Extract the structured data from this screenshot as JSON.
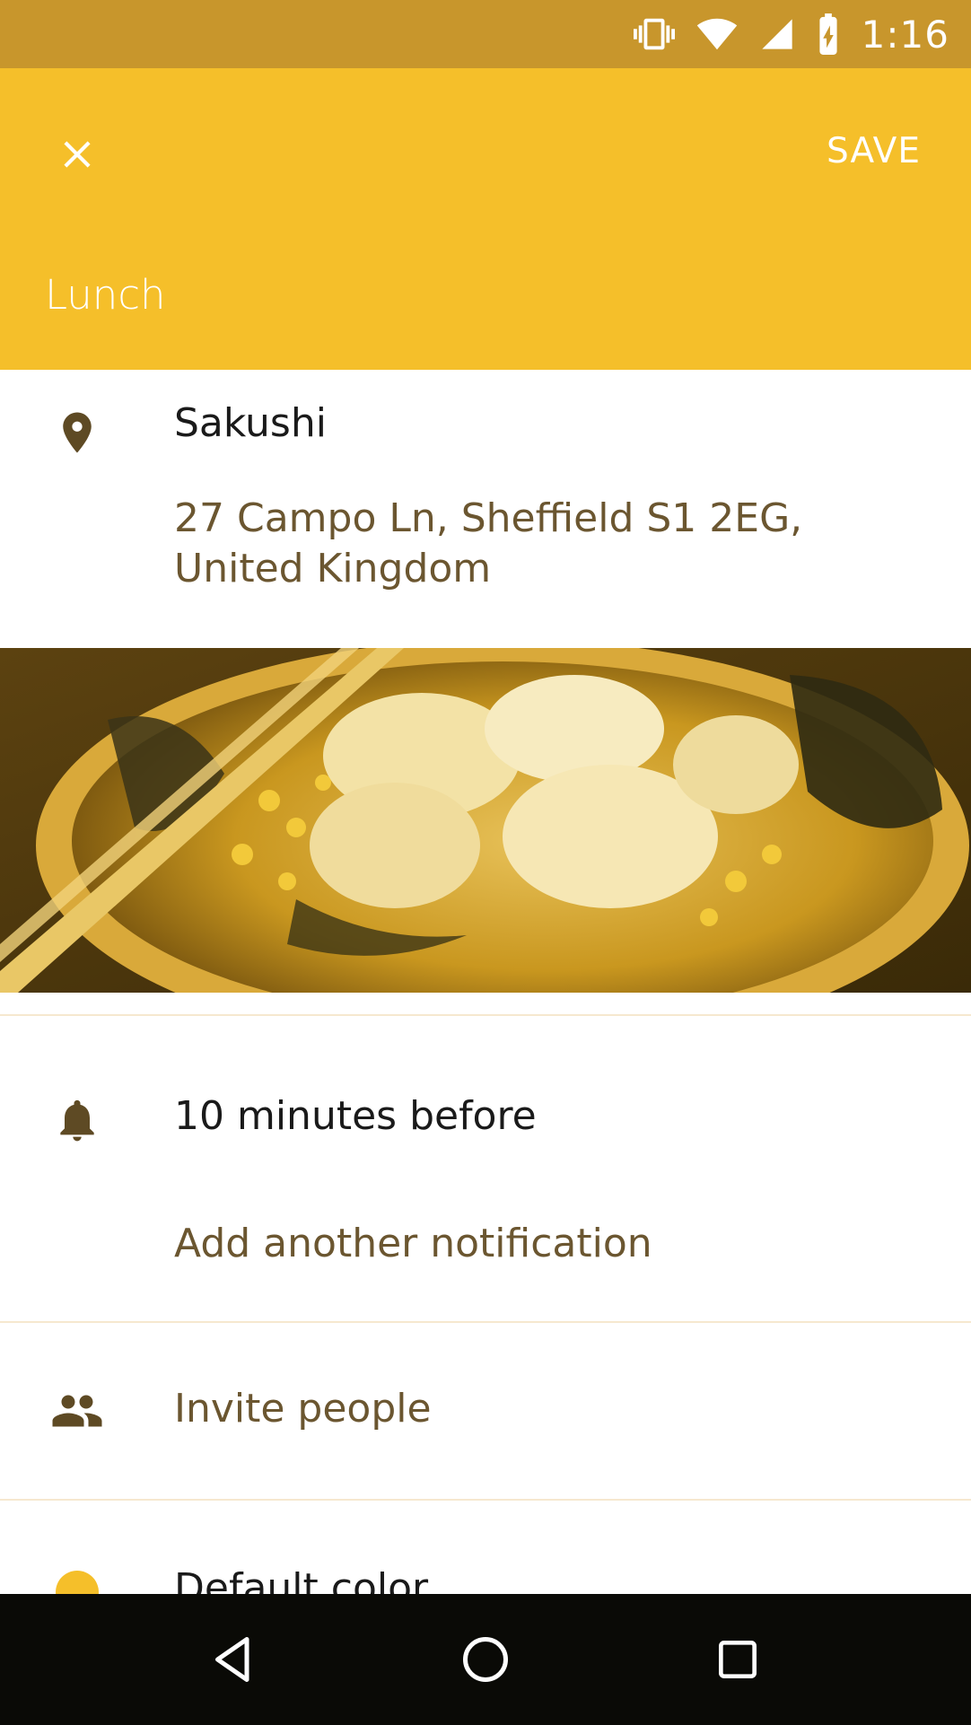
{
  "status_bar": {
    "time": "1:16",
    "icons": [
      "vibrate-icon",
      "wifi-icon",
      "cell-signal-icon",
      "battery-charging-icon"
    ]
  },
  "app_bar": {
    "close_icon": "close-icon",
    "save_label": "SAVE",
    "title": "Lunch",
    "color": "#F5BF2A"
  },
  "location": {
    "icon": "location-pin-icon",
    "name": "Sakushi",
    "address": "27 Campo Ln, Sheffield S1 2EG, United Kingdom"
  },
  "photo": {
    "subject": "ramen bowl photo"
  },
  "notifications": {
    "icon": "bell-icon",
    "current": "10 minutes before",
    "add_label": "Add another notification"
  },
  "invite": {
    "icon": "people-icon",
    "label": "Invite people"
  },
  "color": {
    "label": "Default color",
    "swatch": "#F5BF2A"
  },
  "nav_bar": {
    "icons": [
      "back-icon",
      "home-icon",
      "recents-icon"
    ]
  },
  "colors": {
    "status_bar": "#C8962C",
    "accent": "#F5BF2A",
    "secondary_text": "#6b5630",
    "icon": "#5e4a24"
  }
}
